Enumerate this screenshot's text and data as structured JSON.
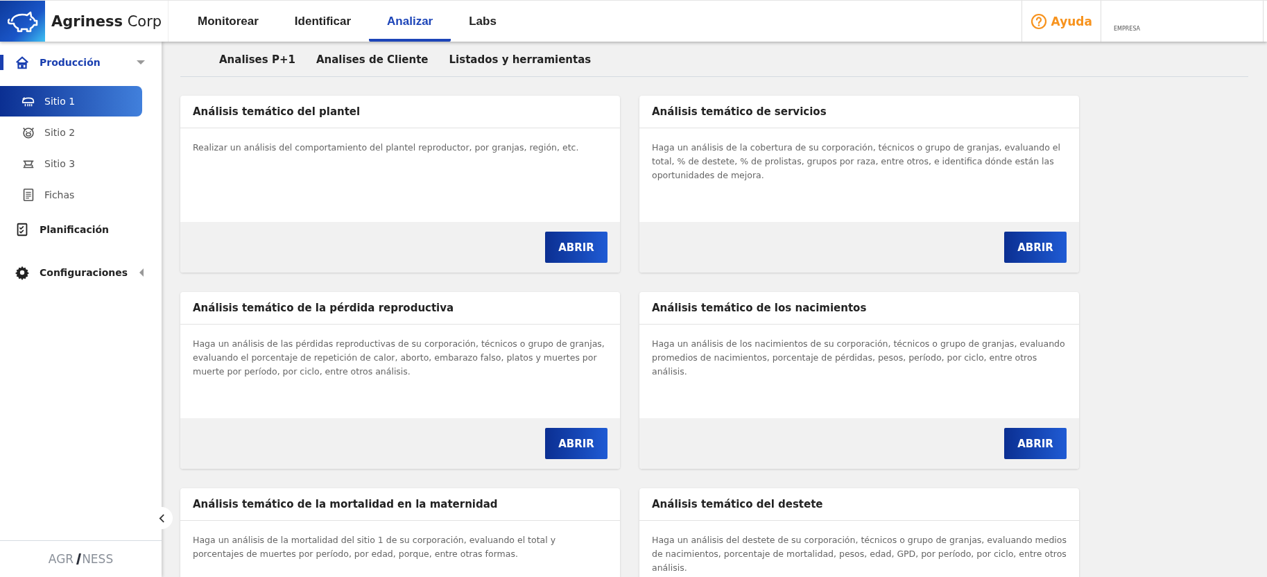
{
  "header": {
    "brand": "**Agriness** Corp",
    "nav": [
      {
        "label": "Monitorear",
        "selected": false
      },
      {
        "label": "Identificar",
        "selected": false
      },
      {
        "label": "Analizar",
        "selected": true
      },
      {
        "label": "Labs",
        "selected": false
      }
    ],
    "help": "Ayuda",
    "company_label": "EMPRESA"
  },
  "sidebar": {
    "items": [
      {
        "label": "Producción",
        "expanded": true,
        "selected": true,
        "children": [
          {
            "label": "Sitio 1",
            "selected": true
          },
          {
            "label": "Sitio 2",
            "selected": false
          },
          {
            "label": "Sitio 3",
            "selected": false
          },
          {
            "label": "Fichas",
            "selected": false
          }
        ]
      },
      {
        "label": "Planificación",
        "selected": false
      },
      {
        "label": "Configuraciones",
        "expanded": false,
        "selected": false
      }
    ],
    "footer_logo": {
      "left": "AGR",
      "right": "NESS"
    }
  },
  "subtabs": [
    {
      "label": "Analises P+1",
      "selected": false
    },
    {
      "label": "Analises de Cliente",
      "selected": false
    },
    {
      "label": "Listados y herramientas",
      "selected": false
    }
  ],
  "cards": [
    {
      "title": "Análisis temático del plantel",
      "text": "Realizar un análisis del comportamiento del plantel reproductor, por granjas, región, etc.",
      "button": "ABRIR"
    },
    {
      "title": "Análisis temático de servicios",
      "text": "Haga un análisis de la cobertura de su corporación, técnicos o grupo de granjas, evaluando el total, % de destete, % de prolistas, grupos por raza, entre otros, e identifica dónde están las oportunidades de mejora.",
      "button": "ABRIR"
    },
    {
      "title": "Análisis temático de la pérdida reproductiva",
      "text": "Haga un análisis de las pérdidas reproductivas de su corporación, técnicos o grupo de granjas, evaluando el porcentaje de repetición de calor, aborto, embarazo falso, platos y muertes por muerte por período, por ciclo, entre otros análisis.",
      "button": "ABRIR"
    },
    {
      "title": "Análisis temático de los nacimientos",
      "text": "Haga un análisis de los nacimientos de su corporación, técnicos o grupo de granjas, evaluando promedios de nacimientos, porcentaje de pérdidas, pesos, período, por ciclo, entre otros análisis.",
      "button": "ABRIR"
    },
    {
      "title": "Análisis temático de la mortalidad en la maternidad",
      "text": "Haga un análisis de la mortalidad del sitio 1 de su corporación, evaluando el total y porcentajes de muertes por período, por edad, porque, entre otras formas."
    },
    {
      "title": "Análisis temático del destete",
      "text": "Haga un análisis del destete de su corporación, técnicos o grupo de granjas, evaluando medios de nacimientos, porcentaje de mortalidad, pesos, edad, GPD, por período, por ciclo, entre otros análisis."
    }
  ]
}
